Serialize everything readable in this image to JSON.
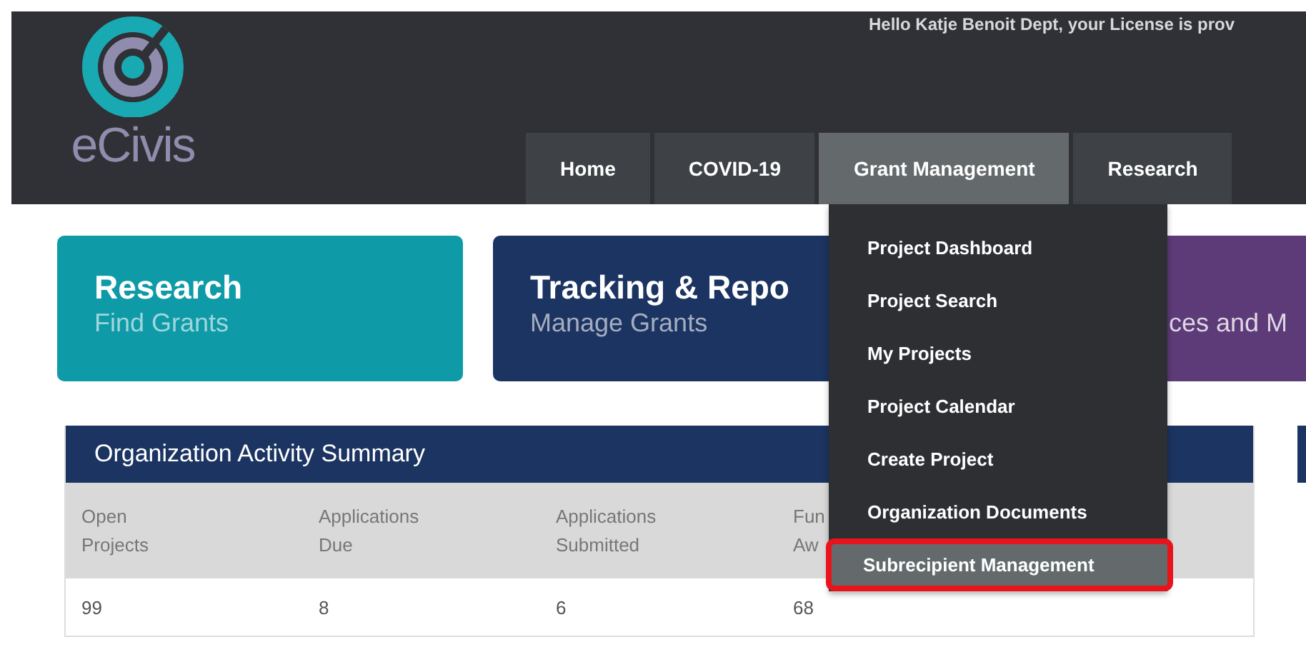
{
  "header": {
    "greeting": "Hello Katje Benoit Dept, your License is prov",
    "logo_text": "eCivis"
  },
  "nav": [
    {
      "label": "Home",
      "selected": false
    },
    {
      "label": "COVID-19",
      "selected": false
    },
    {
      "label": "Grant Management",
      "selected": true
    },
    {
      "label": "Research",
      "selected": false
    }
  ],
  "cards": [
    {
      "title": "Research",
      "subtitle": "Find Grants",
      "color": "#0e9aa7"
    },
    {
      "title": "Tracking & Repo",
      "subtitle": "Manage Grants",
      "color": "#1c3461"
    },
    {
      "subtitle": "ces and M",
      "color": "#5d3a78"
    }
  ],
  "summary": {
    "title": "Organization Activity Summary",
    "columns": [
      [
        "Open",
        "Projects"
      ],
      [
        "Applications",
        "Due"
      ],
      [
        "Applications",
        "Submitted"
      ],
      [
        "Fun",
        "Aw"
      ]
    ],
    "values": [
      "99",
      "8",
      "6",
      "68"
    ]
  },
  "menu": [
    {
      "label": "Project Dashboard",
      "selected": false
    },
    {
      "label": "Project Search",
      "selected": false
    },
    {
      "label": "My Projects",
      "selected": false
    },
    {
      "label": "Project Calendar",
      "selected": false
    },
    {
      "label": "Create Project",
      "selected": false
    },
    {
      "label": "Organization Documents",
      "selected": false
    },
    {
      "label": "Subrecipient Management",
      "selected": true
    }
  ]
}
